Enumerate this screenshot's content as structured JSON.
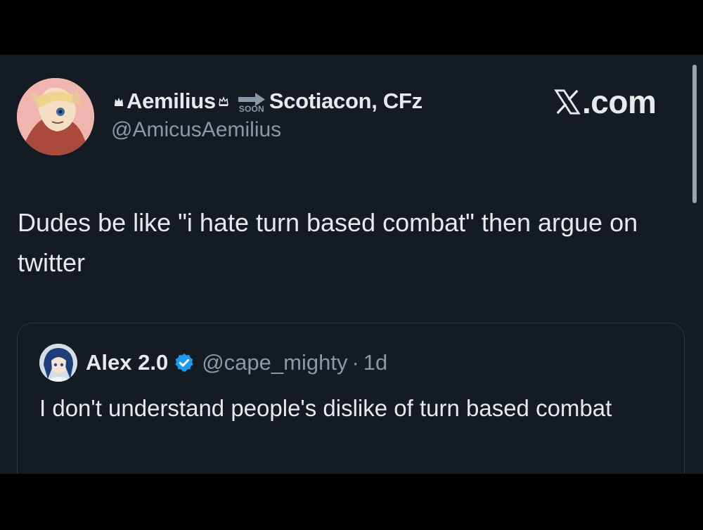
{
  "tweet": {
    "display_name": "Aemilius",
    "name_suffix": "Scotiacon, CFz",
    "soon_label": "SOON",
    "handle": "@AmicusAemilius",
    "text": "Dudes be like \"i hate turn based combat\" then argue on twitter"
  },
  "brand": {
    "label": ".com"
  },
  "quoted_tweet": {
    "display_name": "Alex 2.0",
    "handle": "@cape_mighty",
    "separator": "·",
    "time": "1d",
    "text": "I don't understand people's dislike of turn based combat"
  },
  "colors": {
    "background": "#151b23",
    "primary_text": "#e7e9ea",
    "secondary_text": "#8b98a5",
    "verified_badge": "#1d9bf0",
    "border": "#2f3640"
  }
}
